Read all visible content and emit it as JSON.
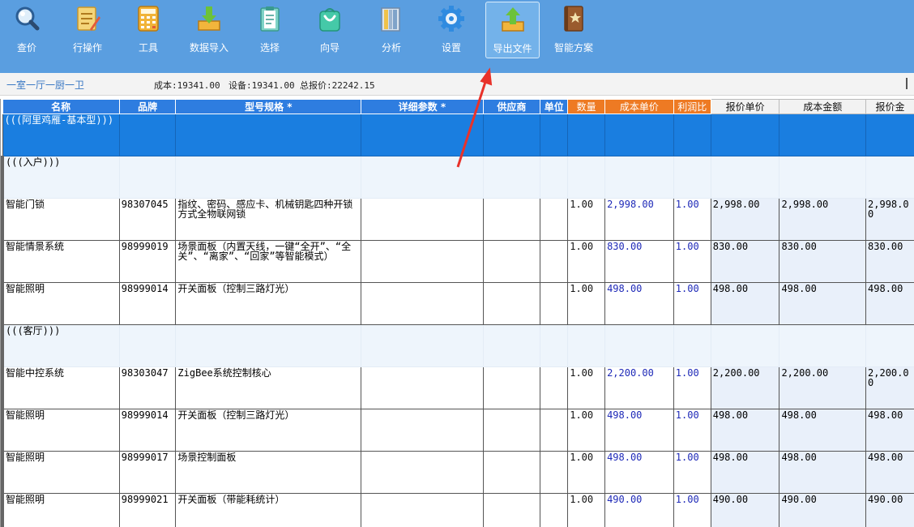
{
  "toolbar": {
    "items": [
      {
        "label": "查价",
        "icon": "magnifier-icon"
      },
      {
        "label": "行操作",
        "icon": "edit-list-icon"
      },
      {
        "label": "工具",
        "icon": "calculator-icon"
      },
      {
        "label": "数据导入",
        "icon": "import-icon"
      },
      {
        "label": "选择",
        "icon": "clipboard-icon"
      },
      {
        "label": "向导",
        "icon": "shopping-bag-icon"
      },
      {
        "label": "分析",
        "icon": "books-icon"
      },
      {
        "label": "设置",
        "icon": "gear-icon"
      },
      {
        "label": "导出文件",
        "icon": "export-icon",
        "active": true
      },
      {
        "label": "智能方案",
        "icon": "book-star-icon"
      }
    ]
  },
  "status": {
    "room": "一室一厅一厨一卫",
    "cost": "成本:19341.00",
    "equipment": "设备:19341.00",
    "total": "总报价:22242.15"
  },
  "grid": {
    "headers": [
      "名称",
      "品牌",
      "型号规格 *",
      "详细参数 *",
      "供应商",
      "单位",
      "数量",
      "成本单价",
      "利润比",
      "报价单价",
      "成本金额",
      "报价金"
    ],
    "group_title": "(((阿里鸡雁-基本型)))",
    "sections": [
      {
        "title": "(((入户)))",
        "rows": [
          {
            "name": "智能门锁",
            "brand": "98307045",
            "model": "指纹、密码、感应卡、机械钥匙四种开锁方式全物联网锁",
            "qty": "1.00",
            "unit_cost": "2,998.00",
            "ratio": "1.00",
            "quote_price": "2,998.00",
            "cost_total": "2,998.00",
            "quote_total": "2,998.00"
          },
          {
            "name": "智能情景系统",
            "brand": "98999019",
            "model": "场景面板（内置天线，一键“全开”、“全关”、“离家”、“回家”等智能模式）",
            "qty": "1.00",
            "unit_cost": "830.00",
            "ratio": "1.00",
            "quote_price": "830.00",
            "cost_total": "830.00",
            "quote_total": "830.00"
          },
          {
            "name": "智能照明",
            "brand": "98999014",
            "model": "开关面板（控制三路灯光）",
            "qty": "1.00",
            "unit_cost": "498.00",
            "ratio": "1.00",
            "quote_price": "498.00",
            "cost_total": "498.00",
            "quote_total": "498.00"
          }
        ]
      },
      {
        "title": "(((客厅)))",
        "rows": [
          {
            "name": "智能中控系统",
            "brand": "98303047",
            "model": "ZigBee系统控制核心",
            "qty": "1.00",
            "unit_cost": "2,200.00",
            "ratio": "1.00",
            "quote_price": "2,200.00",
            "cost_total": "2,200.00",
            "quote_total": "2,200.00"
          },
          {
            "name": "智能照明",
            "brand": "98999014",
            "model": "开关面板（控制三路灯光）",
            "qty": "1.00",
            "unit_cost": "498.00",
            "ratio": "1.00",
            "quote_price": "498.00",
            "cost_total": "498.00",
            "quote_total": "498.00"
          },
          {
            "name": "智能照明",
            "brand": "98999017",
            "model": "场景控制面板",
            "qty": "1.00",
            "unit_cost": "498.00",
            "ratio": "1.00",
            "quote_price": "498.00",
            "cost_total": "498.00",
            "quote_total": "498.00"
          },
          {
            "name": "智能照明",
            "brand": "98999021",
            "model": "开关面板（带能耗统计）",
            "qty": "1.00",
            "unit_cost": "490.00",
            "ratio": "1.00",
            "quote_price": "490.00",
            "cost_total": "490.00",
            "quote_total": "490.00"
          }
        ]
      }
    ]
  },
  "colors": {
    "toolbar_bg": "#5a9ee0",
    "header_blue": "#2e7de0",
    "header_orange": "#ee7a23",
    "annotation_arrow": "#e8322a"
  }
}
